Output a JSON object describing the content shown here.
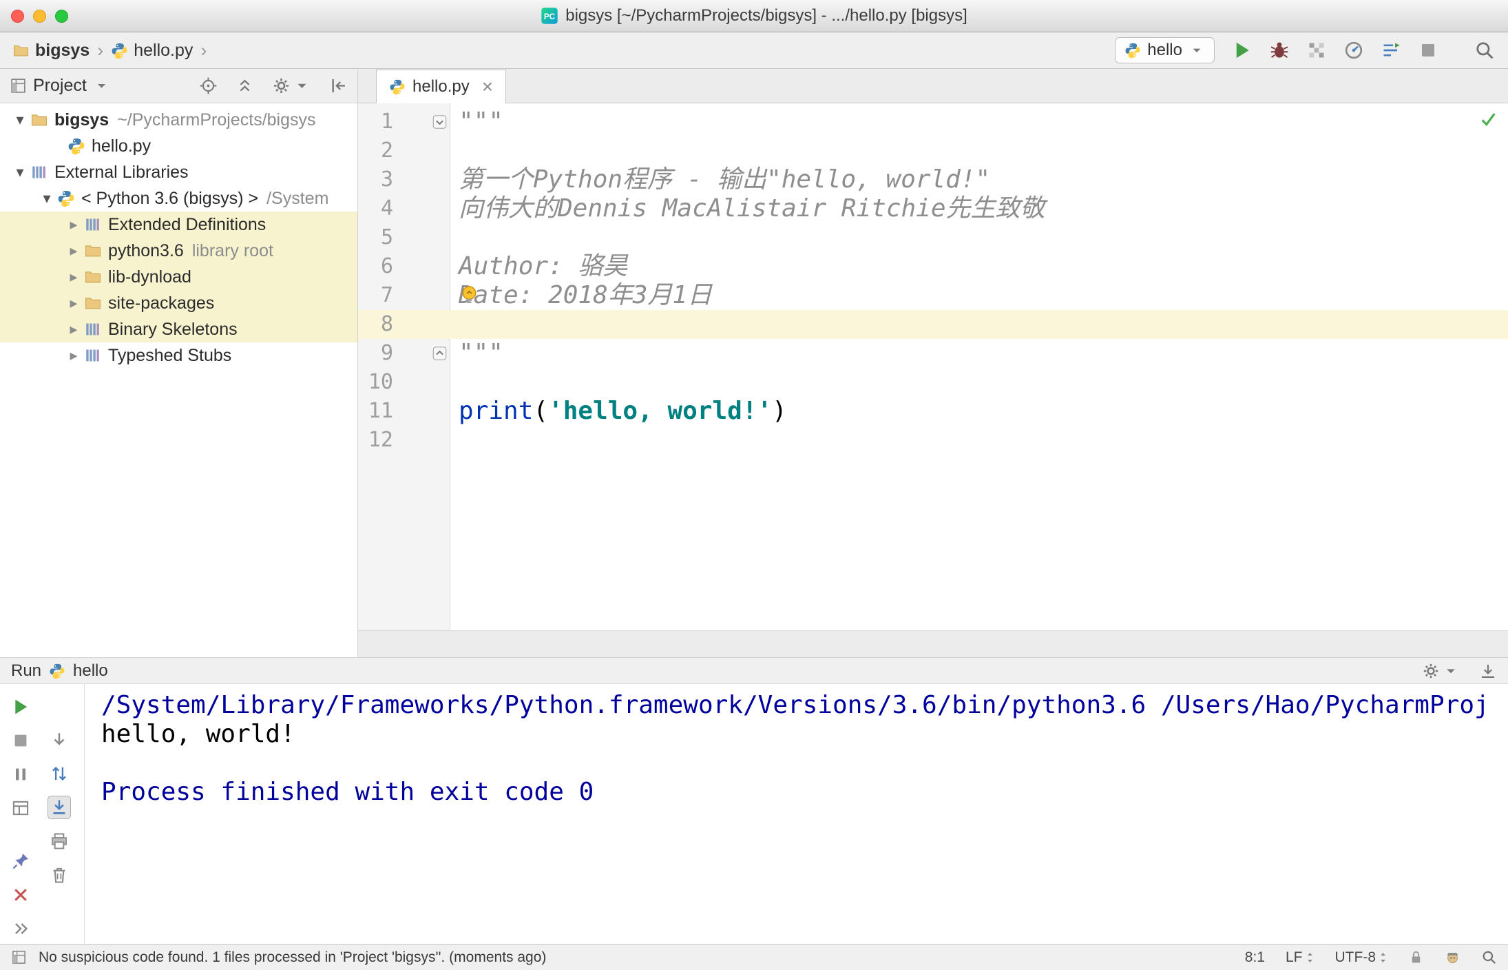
{
  "colors": {
    "accent_green": "#43a047",
    "selection_yellow": "#f8f3cf",
    "caret_row_yellow": "#fbf5da",
    "doc_comment": "#8e8e8e",
    "keyword": "#0033b3",
    "string": "#008080",
    "console_info": "#00009c"
  },
  "titlebar": {
    "title": "bigsys [~/PycharmProjects/bigsys] - .../hello.py [bigsys]"
  },
  "navbar": {
    "breadcrumb": [
      {
        "icon": "folder",
        "label": "bigsys"
      },
      {
        "icon": "python",
        "label": "hello.py"
      }
    ],
    "run_chip": {
      "icon": "python",
      "label": "hello"
    },
    "actions": [
      {
        "id": "run-button",
        "icon": "run",
        "title": "Run"
      },
      {
        "id": "debug-button",
        "icon": "bug",
        "title": "Debug"
      },
      {
        "id": "coverage-button",
        "icon": "coverage",
        "title": "Run with Coverage"
      },
      {
        "id": "profiler-button",
        "icon": "profiler",
        "title": "Profile"
      },
      {
        "id": "concurrency-button",
        "icon": "concurrency",
        "title": "Concurrency Diagram"
      },
      {
        "id": "stop-button",
        "icon": "stop",
        "title": "Stop"
      },
      {
        "id": "search-everywhere-button",
        "icon": "search",
        "title": "Search Everywhere"
      }
    ]
  },
  "project_panel": {
    "title": "Project",
    "actions": [
      {
        "id": "locate-file-button",
        "icon": "target"
      },
      {
        "id": "collapse-all-button",
        "icon": "collapse"
      },
      {
        "id": "panel-settings-button",
        "icon": "gear",
        "caret": true
      },
      {
        "id": "hide-panel-button",
        "icon": "hide"
      }
    ],
    "tree": [
      {
        "id": "bigsys-root",
        "arrow": "down",
        "icon": "folder",
        "label": "bigsys",
        "suffix": "~/PycharmProjects/bigsys",
        "bold": true,
        "indent": 0
      },
      {
        "id": "hello-py",
        "arrow": "none",
        "icon": "python",
        "label": "hello.py",
        "indent": 2
      },
      {
        "id": "external-libraries",
        "arrow": "down",
        "icon": "library",
        "label": "External Libraries",
        "indent": 0
      },
      {
        "id": "python-3-6",
        "arrow": "down",
        "icon": "python",
        "label": "< Python 3.6 (bigsys) >",
        "suffix": "/System",
        "indent": 1
      },
      {
        "id": "extended-definitions",
        "arrow": "right",
        "icon": "library",
        "label": "Extended Definitions",
        "indent": 2,
        "highlight": true
      },
      {
        "id": "python3-6-library-root",
        "arrow": "right",
        "icon": "folder",
        "label": "python3.6",
        "suffix": "library root",
        "indent": 2,
        "highlight": true
      },
      {
        "id": "lib-dynload",
        "arrow": "right",
        "icon": "folder",
        "label": "lib-dynload",
        "indent": 2,
        "highlight": true
      },
      {
        "id": "site-packages",
        "arrow": "right",
        "icon": "folder",
        "label": "site-packages",
        "indent": 2,
        "highlight": true
      },
      {
        "id": "binary-skeletons",
        "arrow": "right",
        "icon": "library",
        "label": "Binary Skeletons",
        "indent": 2,
        "highlight": true
      },
      {
        "id": "typeshed-stubs",
        "arrow": "right",
        "icon": "library",
        "label": "Typeshed Stubs",
        "indent": 2,
        "highlight": false
      }
    ]
  },
  "editor": {
    "tab": {
      "icon": "python",
      "label": "hello.py",
      "close": "×"
    },
    "lines": [
      {
        "n": "1",
        "fold": "start",
        "segments": [
          {
            "t": "\"\"\"",
            "c": "doc"
          }
        ]
      },
      {
        "n": "2",
        "segments": []
      },
      {
        "n": "3",
        "segments": [
          {
            "t": "第一个Python程序 - 输出\"hello, world!\"",
            "c": "doc"
          }
        ]
      },
      {
        "n": "4",
        "segments": [
          {
            "t": "向伟大的Dennis MacAlistair Ritchie先生致敬",
            "c": "doc"
          }
        ]
      },
      {
        "n": "5",
        "segments": []
      },
      {
        "n": "6",
        "segments": [
          {
            "t": "Author: 骆昊",
            "c": "doc"
          }
        ]
      },
      {
        "n": "7",
        "bulb": true,
        "segments": [
          {
            "t": "Date: 2018年3月1日",
            "c": "doc"
          }
        ]
      },
      {
        "n": "8",
        "current": true,
        "segments": []
      },
      {
        "n": "9",
        "fold": "end",
        "segments": [
          {
            "t": "\"\"\"",
            "c": "doc"
          }
        ]
      },
      {
        "n": "10",
        "segments": []
      },
      {
        "n": "11",
        "segments": [
          {
            "t": "print",
            "c": "kw"
          },
          {
            "t": "(",
            "c": "plain"
          },
          {
            "t": "'hello, world!'",
            "c": "str"
          },
          {
            "t": ")",
            "c": "plain"
          }
        ]
      },
      {
        "n": "12",
        "segments": []
      }
    ]
  },
  "run_panel": {
    "title": "Run",
    "config": {
      "icon": "python",
      "label": "hello"
    },
    "header_actions": [
      {
        "id": "run-settings-button",
        "icon": "gear",
        "caret": true
      },
      {
        "id": "hide-run-panel-button",
        "icon": "hide-down"
      }
    ],
    "toolbar_col1": [
      {
        "id": "rerun-button",
        "icon": "run"
      },
      {
        "id": "stop-run-button",
        "icon": "stop"
      },
      {
        "id": "pause-output-button",
        "icon": "pause"
      },
      {
        "id": "restore-layout-button",
        "icon": "layout"
      },
      {
        "id": "pin-tab-button",
        "icon": "pin",
        "gap_before": true
      },
      {
        "id": "close-run-tab-button",
        "icon": "close-red"
      },
      {
        "id": "more-options-button",
        "icon": "chevrons"
      }
    ],
    "toolbar_col2": [
      {
        "id": "down-the-stack-button",
        "icon": "arrow-down"
      },
      {
        "id": "soft-wrap-button",
        "icon": "softwrap"
      },
      {
        "id": "scroll-to-end-button",
        "icon": "scrollend",
        "active": true
      },
      {
        "id": "print-console-button",
        "icon": "printer"
      },
      {
        "id": "clear-all-button",
        "icon": "trash"
      }
    ],
    "console": [
      {
        "c": "info",
        "t": "/System/Library/Frameworks/Python.framework/Versions/3.6/bin/python3.6 /Users/Hao/PycharmProj"
      },
      {
        "c": "plain",
        "t": "hello, world!"
      },
      {
        "c": "plain",
        "t": ""
      },
      {
        "c": "info",
        "t": "Process finished with exit code 0"
      }
    ]
  },
  "statusbar": {
    "message": "No suspicious code found. 1 files processed in 'Project 'bigsys''. (moments ago)",
    "caret_position": "8:1",
    "line_separator": "LF",
    "encoding": "UTF-8"
  }
}
